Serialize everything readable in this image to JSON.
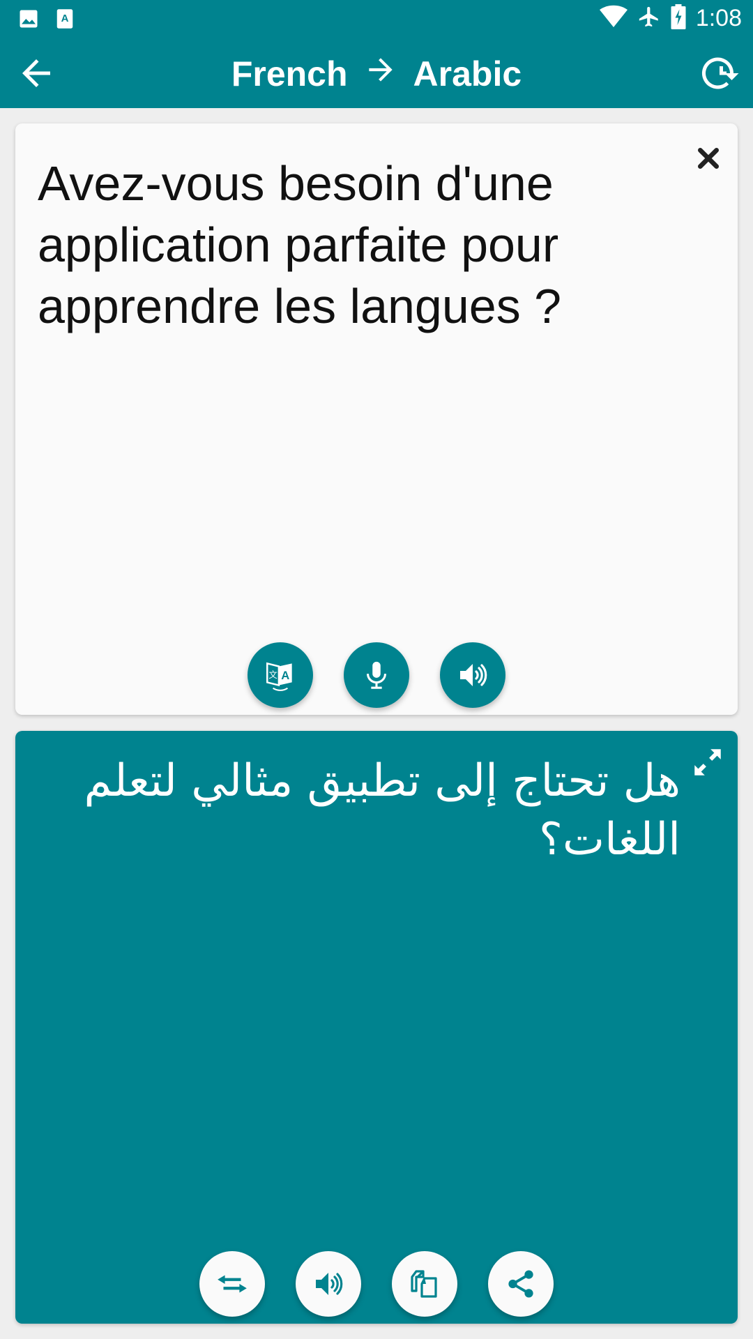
{
  "status_bar": {
    "time": "1:08",
    "left_icons": [
      "image-icon",
      "app-translate-icon"
    ],
    "right_icons": [
      "wifi-icon",
      "airplane-mode-icon",
      "battery-charging-icon"
    ]
  },
  "app_bar": {
    "source_language": "French",
    "arrow": "→",
    "target_language": "Arabic",
    "back_icon": "arrow-back-icon",
    "history_icon": "history-icon"
  },
  "source_card": {
    "text": "Avez-vous besoin d'une application parfaite pour apprendre les langues ?",
    "clear_icon": "close-icon",
    "buttons": [
      {
        "name": "translate-button",
        "icon": "translate-icon"
      },
      {
        "name": "microphone-button",
        "icon": "microphone-icon"
      },
      {
        "name": "speak-source-button",
        "icon": "volume-icon"
      }
    ]
  },
  "target_card": {
    "text": "هل تحتاج إلى تطبيق مثالي لتعلم اللغات؟",
    "expand_icon": "fullscreen-expand-icon",
    "buttons": [
      {
        "name": "swap-languages-button",
        "icon": "swap-arrows-icon"
      },
      {
        "name": "speak-target-button",
        "icon": "volume-icon"
      },
      {
        "name": "copy-button",
        "icon": "copy-icon"
      },
      {
        "name": "share-button",
        "icon": "share-icon"
      }
    ]
  },
  "colors": {
    "primary": "#00838F",
    "background": "#EEEEEE",
    "card": "#FAFAFA"
  }
}
